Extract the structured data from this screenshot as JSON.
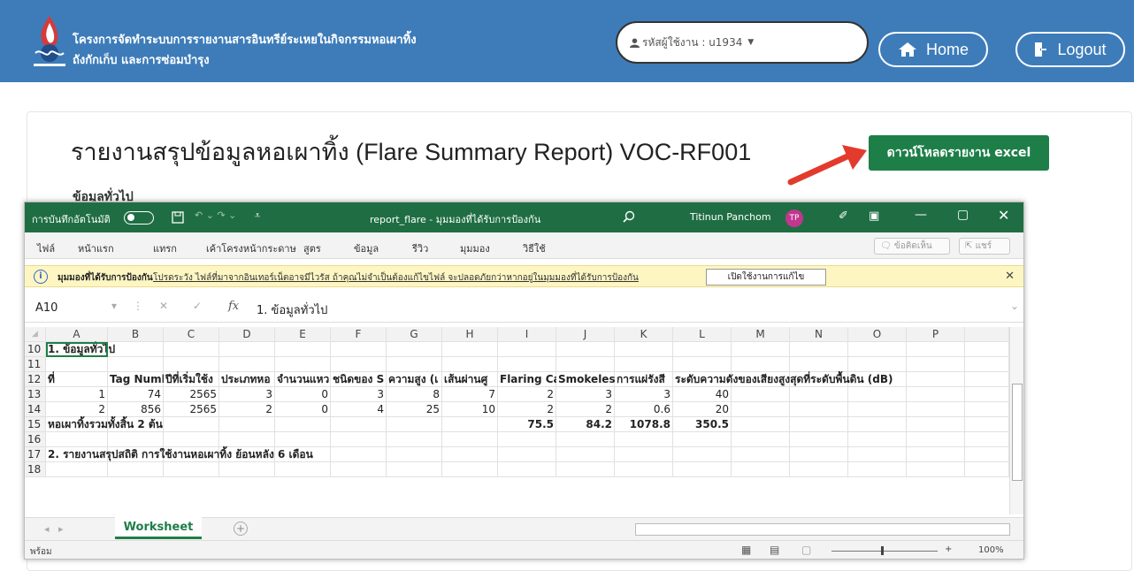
{
  "header": {
    "title_line1": "โครงการจัดทำระบบการรายงานสารอินทรีย์ระเหยในกิจกรรมหอเผาทิ้ง",
    "title_line2": "ถังกักเก็บ และการซ่อมบำรุง",
    "user_label": "รหัสผู้ใช้งาน : u1934",
    "home_label": "Home",
    "logout_label": "Logout",
    "brand_color": "#3d7cb9"
  },
  "page": {
    "title": "รายงานสรุปข้อมูลหอเผาทิ้ง (Flare Summary Report) VOC-RF001",
    "download_label": "ดาวน์โหลดรายงาน excel",
    "partial_label": "ข้อมูลทั่วไป"
  },
  "excel": {
    "autosave_label": "การบันทึกอัตโนมัติ",
    "file_title": "report_flare - มุมมองที่ได้รับการป้องกัน",
    "user_name": "Titinun Panchom",
    "user_initials": "TP",
    "menus": [
      "ไฟล์",
      "หน้าแรก",
      "แทรก",
      "เค้าโครงหน้ากระดาษ",
      "สูตร",
      "ข้อมูล",
      "รีวิว",
      "มุมมอง",
      "วิธีใช้"
    ],
    "comment_btn": "ข้อคิดเห็น",
    "share_btn": "แชร์",
    "warning_bold": "มุมมองที่ได้รับการป้องกัน",
    "warning_text": "โปรดระวัง ไฟล์ที่มาจากอินเทอร์เน็ตอาจมีไวรัส ถ้าคุณไม่จำเป็นต้องแก้ไขไฟล์ จะปลอดภัยกว่าหากอยู่ในมุมมองที่ได้รับการป้องกัน",
    "enable_edit": "เปิดใช้งานการแก้ไข",
    "name_box": "A10",
    "formula": "1. ข้อมูลทั่วไป",
    "columns": [
      "A",
      "B",
      "C",
      "D",
      "E",
      "F",
      "G",
      "H",
      "I",
      "J",
      "K",
      "L",
      "M",
      "N",
      "O",
      "P"
    ],
    "rows": [
      {
        "num": "10",
        "cells": {
          "A": "1. ข้อมูลทั่วไป"
        }
      },
      {
        "num": "11",
        "cells": {}
      },
      {
        "num": "12",
        "cells": {
          "A": "ที่",
          "B": "Tag Numb",
          "C": "ปีที่เริ่มใช้ง",
          "D": "ประเภทหอ",
          "E": "จำนวนแหว",
          "F": "ชนิดของ S",
          "G": "ความสูง (เ",
          "H": "เส้นผ่านศู",
          "I": "Flaring Ca",
          "J": "Smokeles",
          "K": "การแผ่รังสี",
          "L": "ระดับความดังของเสียงสูงสุดที่ระดับพื้นดิน (dB)"
        }
      },
      {
        "num": "13",
        "cells": {
          "A": "1",
          "B": "74",
          "C": "2565",
          "D": "3",
          "E": "0",
          "F": "3",
          "G": "8",
          "H": "7",
          "I": "2",
          "J": "3",
          "K": "3",
          "L": "40"
        }
      },
      {
        "num": "14",
        "cells": {
          "A": "2",
          "B": "856",
          "C": "2565",
          "D": "2",
          "E": "0",
          "F": "4",
          "G": "25",
          "H": "10",
          "I": "2",
          "J": "2",
          "K": "0.6",
          "L": "20"
        }
      },
      {
        "num": "15",
        "cells": {
          "A": "หอเผาทิ้งรวมทั้งสิ้น 2 ต้น",
          "I": "75.5",
          "J": "84.2",
          "K": "1078.8",
          "L": "350.5"
        }
      },
      {
        "num": "16",
        "cells": {}
      },
      {
        "num": "17",
        "cells": {
          "A": "2. รายงานสรุปสถิติ การใช้งานหอเผาทิ้ง ย้อนหลัง 6 เดือน"
        }
      },
      {
        "num": "18",
        "cells": {}
      }
    ],
    "sheet_tab": "Worksheet",
    "status_text": "พร้อม",
    "zoom": "100%"
  }
}
